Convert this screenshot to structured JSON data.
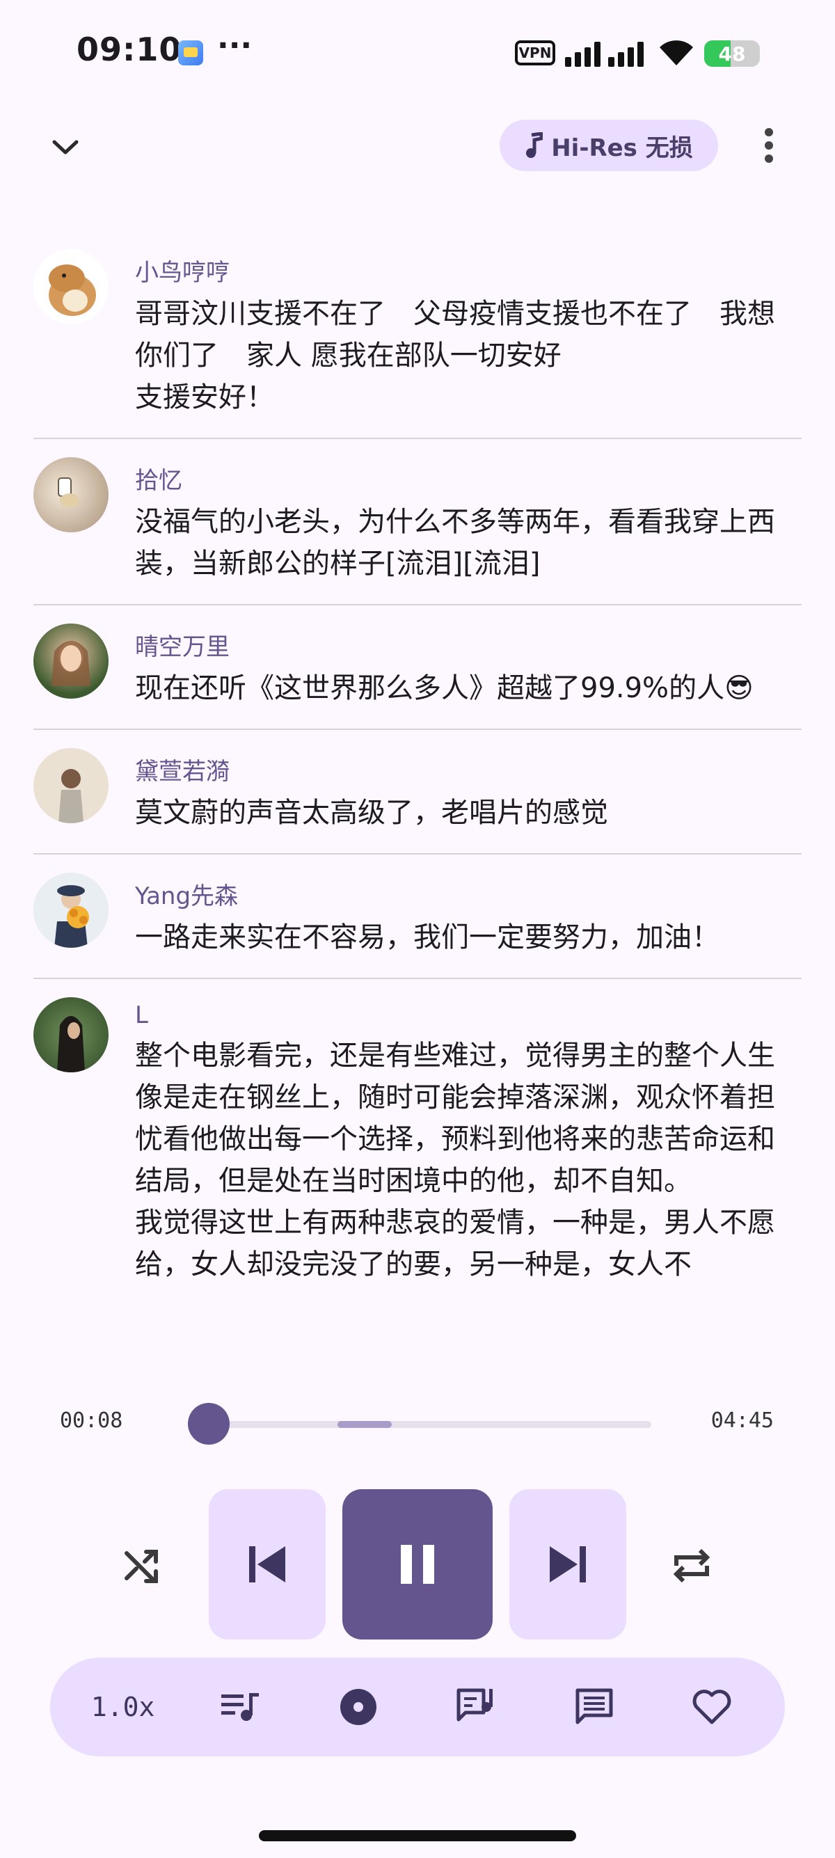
{
  "status_bar": {
    "time": "09:10",
    "more_dots": "···",
    "vpn_label": "VPN",
    "battery_level": 48,
    "battery_text": "48"
  },
  "top_bar": {
    "quality_label": "Hi-Res 无损",
    "icons": [
      "chevron-down-icon",
      "music-note-icon",
      "more-vert-icon"
    ]
  },
  "comments": [
    {
      "user": "小鸟哼哼",
      "text": "哥哥汶川支援不在了　父母疫情支援也不在了　我想你们了　家人 愿我在部队一切安好\n支援安好！"
    },
    {
      "user": "拾忆",
      "text": "没福气的小老头，为什么不多等两年，看看我穿上西装，当新郎公的样子[流泪][流泪]"
    },
    {
      "user": "晴空万里",
      "text": "现在还听《这世界那么多人》超越了99.9%的人😎"
    },
    {
      "user": "黛萱若漪",
      "text": "莫文蔚的声音太高级了，老唱片的感觉"
    },
    {
      "user": "Yang先森",
      "text": "一路走来实在不容易，我们一定要努力，加油！"
    },
    {
      "user": "L",
      "text": "整个电影看完，还是有些难过，觉得男主的整个人生像是走在钢丝上，随时可能会掉落深渊，观众怀着担忧看他做出每一个选择，预料到他将来的悲苦命运和结局，但是处在当时困境中的他，却不自知。\n我觉得这世上有两种悲哀的爱情，一种是，男人不愿给，女人却没完没了的要，另一种是，女人不"
    }
  ],
  "player": {
    "elapsed": "00:08",
    "duration": "04:45",
    "progress_fraction": 0.028,
    "buffer_start_fraction": 0.31,
    "buffer_end_fraction": 0.43,
    "state": "playing"
  },
  "controls": {
    "icons": [
      "shuffle-icon",
      "skip-previous-icon",
      "pause-icon",
      "skip-next-icon",
      "repeat-icon"
    ]
  },
  "bottom_bar": {
    "speed_label": "1.0x",
    "icons": [
      "queue-music-icon",
      "album-icon",
      "lyrics-icon",
      "comment-icon",
      "heart-icon"
    ]
  },
  "colors": {
    "accent": "#65558f",
    "container": "#eaddff",
    "background": "#fdf8ff"
  }
}
